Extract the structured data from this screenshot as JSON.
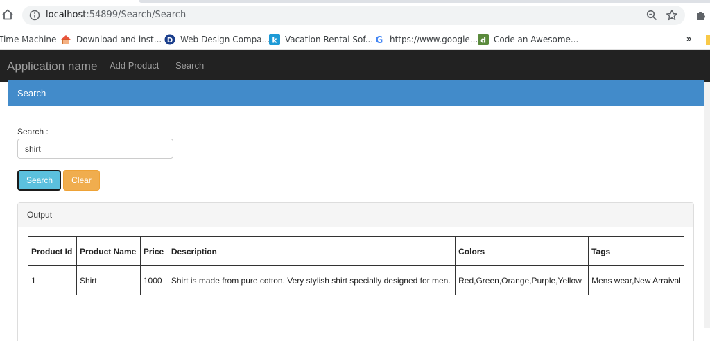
{
  "browser": {
    "url_host": "localhost",
    "url_path": ":54899/Search/Search",
    "bookmarks": [
      {
        "label": "Time Machine"
      },
      {
        "label": "Download and inst..."
      },
      {
        "label": "Web Design Compa..."
      },
      {
        "label": "Vacation Rental Sof..."
      },
      {
        "label": "https://www.google..."
      },
      {
        "label": "Code an Awesome..."
      }
    ],
    "more": "»"
  },
  "navbar": {
    "brand": "Application name",
    "links": [
      "Add Product",
      "Search"
    ]
  },
  "panel": {
    "title": "Search",
    "search_label": "Search :",
    "search_value": "shirt",
    "search_button": "Search",
    "clear_button": "Clear",
    "output_title": "Output"
  },
  "table": {
    "headers": [
      "Product Id",
      "Product Name",
      "Price",
      "Description",
      "Colors",
      "Tags"
    ],
    "rows": [
      [
        "1",
        "Shirt",
        "1000",
        "Shirt is made from pure cotton. Very stylish shirt specially designed for men.",
        "Red,Green,Orange,Purple,Yellow",
        "Mens wear,New Arraival"
      ]
    ]
  },
  "colors": {
    "primary": "#428bca",
    "info": "#5bc0de",
    "warning": "#f0ad4e",
    "navbar": "#222222"
  }
}
